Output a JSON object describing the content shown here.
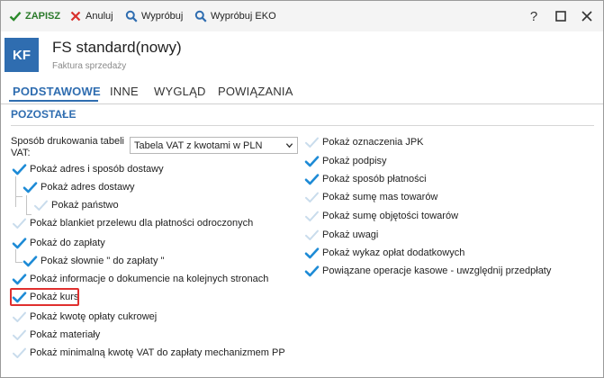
{
  "toolbar": {
    "save": "ZAPISZ",
    "cancel": "Anuluj",
    "try": "Wypróbuj",
    "try_eko": "Wypróbuj EKO",
    "help": "?"
  },
  "header": {
    "badge": "KF",
    "title": "FS standard(nowy)",
    "subtitle": "Faktura sprzedaży"
  },
  "tabs": [
    "PODSTAWOWE",
    "INNE",
    "WYGLĄD",
    "POWIĄZANIA"
  ],
  "section": {
    "title": "POZOSTAŁE"
  },
  "vat_print": {
    "label_line1": "Sposób drukowania tabeli",
    "label_line2": "VAT:",
    "value": "Tabela VAT z kwotami w PLN"
  },
  "left_options": [
    {
      "label": "Pokaż adres i sposób dostawy",
      "checked": true
    },
    {
      "label": "Pokaż adres dostawy",
      "checked": true
    },
    {
      "label": "Pokaż państwo",
      "checked": false
    },
    {
      "label": "Pokaż blankiet przelewu dla płatności odroczonych",
      "checked": false
    },
    {
      "label": "Pokaż do zapłaty",
      "checked": true
    },
    {
      "label": "Pokaż słownie \" do zapłaty \"",
      "checked": true
    },
    {
      "label": "Pokaż informacje o dokumencie na kolejnych stronach",
      "checked": true
    },
    {
      "label": "Pokaż kurs",
      "checked": true
    },
    {
      "label": "Pokaż kwotę opłaty cukrowej",
      "checked": false
    },
    {
      "label": "Pokaż materiały",
      "checked": false
    },
    {
      "label": "Pokaż minimalną kwotę VAT do zapłaty mechanizmem PP",
      "checked": false
    }
  ],
  "right_options": [
    {
      "label": "Pokaż oznaczenia JPK",
      "checked": false
    },
    {
      "label": "Pokaż podpisy",
      "checked": true
    },
    {
      "label": "Pokaż sposób płatności",
      "checked": true
    },
    {
      "label": "Pokaż sumę mas towarów",
      "checked": false
    },
    {
      "label": "Pokaż sumę objętości towarów",
      "checked": false
    },
    {
      "label": "Pokaż uwagi",
      "checked": false
    },
    {
      "label": "Pokaż wykaz opłat dodatkowych",
      "checked": true
    },
    {
      "label": "Powiązane operacje kasowe - uwzględnij przedpłaty",
      "checked": true
    }
  ],
  "colors": {
    "accent": "#2f6db0",
    "check_on": "#1e8bd6",
    "check_off": "#c9dcec",
    "save": "#2b7a2b",
    "cancel": "#d9302c",
    "highlight": "#e0302f"
  }
}
